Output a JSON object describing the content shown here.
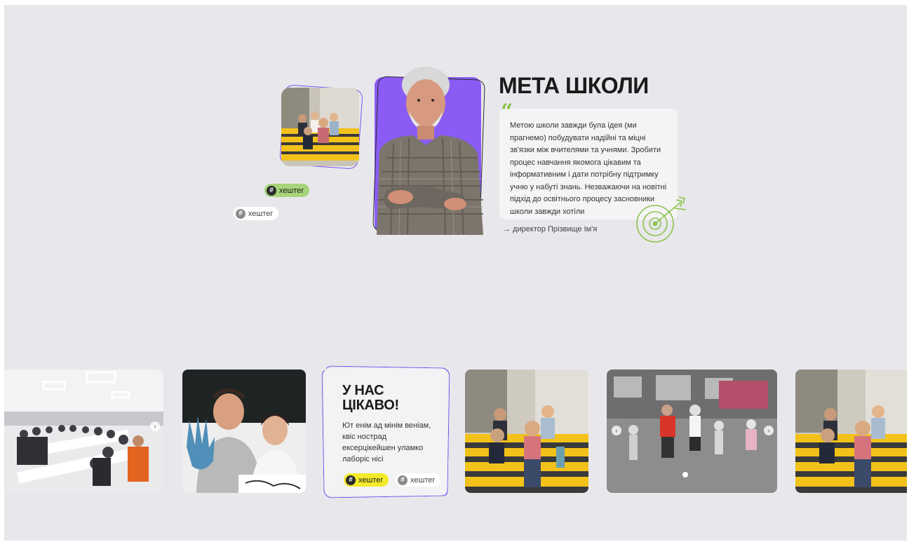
{
  "goal": {
    "title": "МЕТА ШКОЛИ",
    "quote_mark": "“",
    "quote_text": "Метою школи завжди була ідея (ми прагнемо) побудувати надійні та міцні зв'язки між вчителями та учнями. Зробити процес навчання якомога цікавим та інформативним і дати потрібну підтримку учню у набуті знань. Незважаючи на новітні підхід до освітнього процесу засновники школи завжди хотіли",
    "author": "→ директор Прізвище Ім'я"
  },
  "top_tags": [
    {
      "hash": "#",
      "label": "хештег"
    },
    {
      "hash": "#",
      "label": "хештег"
    }
  ],
  "info_card": {
    "title_line1": "У НАС",
    "title_line2": "ЦІКАВО!",
    "text": "Ют енім ад мінім веніам, квіс нострад ексерцікейшен уламко лаборіс нісі",
    "tags": [
      {
        "hash": "#",
        "label": "хештег"
      },
      {
        "hash": "#",
        "label": "хештег"
      }
    ]
  },
  "nav": {
    "prev": "‹",
    "next": "›"
  },
  "colors": {
    "background": "#e8e8ec",
    "accent_purple": "#8a5cf5",
    "accent_green": "#a7d47a",
    "accent_yellow": "#f3ea2a"
  }
}
